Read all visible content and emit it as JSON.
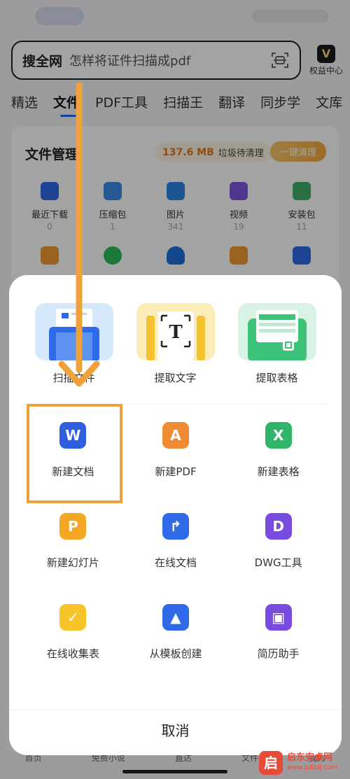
{
  "search": {
    "scope": "搜全网",
    "query": "怎样将证件扫描成pdf"
  },
  "vip": {
    "icon_text": "V",
    "label": "权益中心"
  },
  "tabs": [
    "精选",
    "文件",
    "PDF工具",
    "扫描王",
    "翻译",
    "同步学",
    "文库"
  ],
  "file_card": {
    "title": "文件管理",
    "junk_size": "137.6 MB",
    "junk_label": "垃圾待清理",
    "clean_button": "一键清理",
    "categories": [
      {
        "label": "最近下载",
        "count": "0",
        "color": "#2f6ae8"
      },
      {
        "label": "压缩包",
        "count": "1",
        "color": "#3b8bea"
      },
      {
        "label": "图片",
        "count": "341",
        "color": "#2b84e6"
      },
      {
        "label": "视频",
        "count": "19",
        "color": "#7d55e0"
      },
      {
        "label": "安装包",
        "count": "11",
        "color": "#3cb06a"
      }
    ],
    "row2_colors": [
      "#f09a34",
      "#2dbc55",
      "#1d6fd8",
      "#f09a34",
      "#2f6ae8"
    ]
  },
  "sheet": {
    "tools": [
      {
        "label": "扫描文件",
        "icon": "scan-doc-icon"
      },
      {
        "label": "提取文字",
        "icon": "text-extract-icon"
      },
      {
        "label": "提取表格",
        "icon": "table-extract-icon"
      }
    ],
    "items": [
      {
        "label": "新建文档",
        "icon": "word-icon",
        "glyph": "W",
        "color": "#2f5fe0"
      },
      {
        "label": "新建PDF",
        "icon": "pdf-icon",
        "glyph": "A",
        "color": "#f08a33"
      },
      {
        "label": "新建表格",
        "icon": "excel-icon",
        "glyph": "X",
        "color": "#2fb46a"
      },
      {
        "label": "新建幻灯片",
        "icon": "ppt-icon",
        "glyph": "P",
        "color": "#f5a623"
      },
      {
        "label": "在线文档",
        "icon": "online-doc-icon",
        "glyph": "↱",
        "color": "#2f6ae8"
      },
      {
        "label": "DWG工具",
        "icon": "dwg-icon",
        "glyph": "D",
        "color": "#7a4be0"
      },
      {
        "label": "在线收集表",
        "icon": "collect-form-icon",
        "glyph": "✓",
        "color": "#f7c52a"
      },
      {
        "label": "从模板创建",
        "icon": "template-icon",
        "glyph": "▲",
        "color": "#2f6ae8"
      },
      {
        "label": "简历助手",
        "icon": "resume-icon",
        "glyph": "▣",
        "color": "#7a4be0"
      }
    ],
    "cancel": "取消"
  },
  "bottom_nav": [
    "首页",
    "免费小说",
    "直达",
    "文件",
    "我的"
  ],
  "watermark": {
    "logo": "启",
    "name": "启东安卓网",
    "url": "www.qdltdj.com"
  }
}
